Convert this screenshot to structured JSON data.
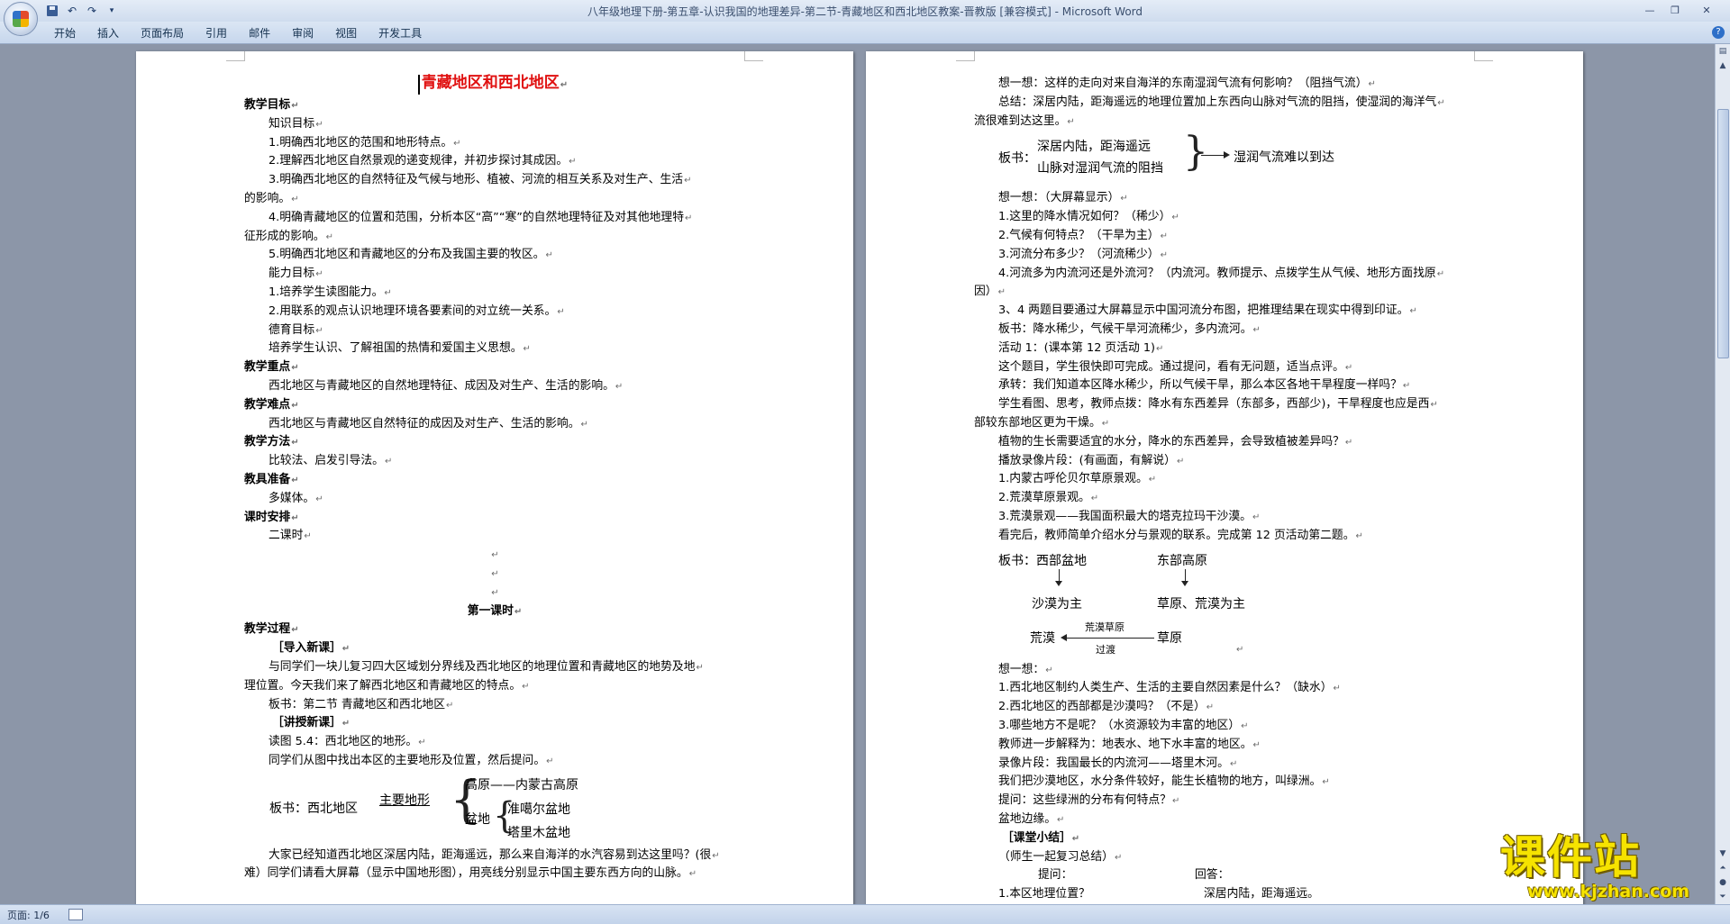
{
  "window": {
    "title": "八年级地理下册-第五章-认识我国的地理差异-第二节-青藏地区和西北地区教案-晋教版 [兼容模式] - Microsoft Word",
    "qat": [
      "save-icon",
      "undo-icon",
      "redo-icon",
      "customize-icon"
    ]
  },
  "ribbon": {
    "tabs": [
      "开始",
      "插入",
      "页面布局",
      "引用",
      "邮件",
      "审阅",
      "视图",
      "开发工具"
    ]
  },
  "left_page": {
    "title": "青藏地区和西北地区",
    "lines_top": [
      {
        "t": "教学目标",
        "c": "bold"
      },
      {
        "t": "知识目标",
        "c": "ind1"
      },
      {
        "t": "1.明确西北地区的范围和地形特点。",
        "c": "ind1"
      },
      {
        "t": "2.理解西北地区自然景观的递变规律，并初步探讨其成因。",
        "c": "ind1"
      },
      {
        "t": "3.明确西北地区的自然特征及气候与地形、植被、河流的相互关系及对生产、生活",
        "c": "ind1"
      },
      {
        "t": "的影响。",
        "c": ""
      },
      {
        "t": "4.明确青藏地区的位置和范围，分析本区“高”“寒”的自然地理特征及对其他地理特",
        "c": "ind1"
      },
      {
        "t": "征形成的影响。",
        "c": ""
      },
      {
        "t": "5.明确西北地区和青藏地区的分布及我国主要的牧区。",
        "c": "ind1"
      },
      {
        "t": "能力目标",
        "c": "ind1"
      },
      {
        "t": "1.培养学生读图能力。",
        "c": "ind1"
      },
      {
        "t": "2.用联系的观点认识地理环境各要素间的对立统一关系。",
        "c": "ind1"
      },
      {
        "t": "德育目标",
        "c": "ind1"
      },
      {
        "t": "培养学生认识、了解祖国的热情和爱国主义思想。",
        "c": "ind1"
      },
      {
        "t": "教学重点",
        "c": "bold"
      },
      {
        "t": "西北地区与青藏地区的自然地理特征、成因及对生产、生活的影响。",
        "c": "ind1"
      },
      {
        "t": "教学难点",
        "c": "bold"
      },
      {
        "t": "西北地区与青藏地区自然特征的成因及对生产、生活的影响。",
        "c": "ind1"
      },
      {
        "t": "教学方法",
        "c": "bold"
      },
      {
        "t": "比较法、启发引导法。",
        "c": "ind1"
      },
      {
        "t": "教具准备",
        "c": "bold"
      },
      {
        "t": "多媒体。",
        "c": "ind1"
      },
      {
        "t": "课时安排",
        "c": "bold"
      },
      {
        "t": "二课时",
        "c": "ind1"
      },
      {
        "t": "",
        "c": "center"
      },
      {
        "t": "",
        "c": "center"
      },
      {
        "t": "",
        "c": "center"
      },
      {
        "t": "第一课时",
        "c": "bold center"
      },
      {
        "t": "教学过程",
        "c": "bold"
      },
      {
        "t": "［导入新课］",
        "c": "ind2 bold"
      },
      {
        "t": "与同学们一块儿复习四大区域划分界线及西北地区的地理位置和青藏地区的地势及地",
        "c": "ind1"
      },
      {
        "t": "理位置。今天我们来了解西北地区和青藏地区的特点。",
        "c": ""
      },
      {
        "t": "板书：第二节   青藏地区和西北地区",
        "c": "ind1"
      },
      {
        "t": "［讲授新课］",
        "c": "ind2 bold"
      },
      {
        "t": "读图 5.4：西北地区的地形。",
        "c": "ind1"
      },
      {
        "t": "同学们从图中找出本区的主要地形及位置，然后提问。",
        "c": "ind1"
      }
    ],
    "board": {
      "prefix": "板书：西北地区",
      "main": "主要地形",
      "plateau": "高原——内蒙古高原",
      "basin": "盆地",
      "basin1": "准噶尔盆地",
      "basin2": "塔里木盆地"
    },
    "lines_bottom": [
      {
        "t": "大家已经知道西北地区深居内陆，距海遥远，那么来自海洋的水汽容易到达这里吗？(很",
        "c": "ind1"
      },
      {
        "t": "难）同学们请看大屏幕（显示中国地形图），用亮线分别显示中国主要东西方向的山脉。",
        "c": ""
      }
    ]
  },
  "right_page": {
    "lines_a": [
      {
        "t": "想一想：这样的走向对来自海洋的东南湿润气流有何影响？（阻挡气流）",
        "c": "ind1"
      },
      {
        "t": "总结：深居内陆，距海遥远的地理位置加上东西向山脉对气流的阻挡，使湿润的海洋气",
        "c": "ind1"
      },
      {
        "t": "流很难到达这里。",
        "c": ""
      }
    ],
    "board2": {
      "label": "板书：",
      "l1": "深居内陆，距海遥远",
      "l2": "山脉对湿润气流的阻挡",
      "result": "湿润气流难以到达"
    },
    "lines_b": [
      {
        "t": "想一想：（大屏幕显示）",
        "c": "ind1"
      },
      {
        "t": "1.这里的降水情况如何？（稀少）",
        "c": "ind1"
      },
      {
        "t": "2.气候有何特点？（干旱为主）",
        "c": "ind1"
      },
      {
        "t": "3.河流分布多少？（河流稀少）",
        "c": "ind1"
      },
      {
        "t": "4.河流多为内流河还是外流河？（内流河。教师提示、点拨学生从气候、地形方面找原",
        "c": "ind1"
      },
      {
        "t": "因）",
        "c": ""
      },
      {
        "t": "3、4 两题目要通过大屏幕显示中国河流分布图，把推理结果在现实中得到印证。",
        "c": "ind1"
      },
      {
        "t": "板书：降水稀少，气候干旱河流稀少，多内流河。",
        "c": "ind1"
      },
      {
        "t": "活动 1：(课本第 12 页活动 1)",
        "c": "ind1"
      },
      {
        "t": "这个题目，学生很快即可完成。通过提问，看有无问题，适当点评。",
        "c": "ind1"
      },
      {
        "t": "承转：我们知道本区降水稀少，所以气候干旱，那么本区各地干旱程度一样吗？",
        "c": "ind1"
      },
      {
        "t": "学生看图、思考，教师点拨：降水有东西差异（东部多，西部少)，干旱程度也应是西",
        "c": "ind1"
      },
      {
        "t": "部较东部地区更为干燥。",
        "c": ""
      },
      {
        "t": "植物的生长需要适宜的水分，降水的东西差异，会导致植被差异吗？",
        "c": "ind1"
      },
      {
        "t": "播放录像片段：(有画面，有解说）",
        "c": "ind1"
      },
      {
        "t": "1.内蒙古呼伦贝尔草原景观。",
        "c": "ind1"
      },
      {
        "t": "2.荒漠草原景观。",
        "c": "ind1"
      },
      {
        "t": "3.荒漠景观——我国面积最大的塔克拉玛干沙漠。",
        "c": "ind1"
      },
      {
        "t": "看完后，教师简单介绍水分与景观的联系。完成第 12 页活动第二题。",
        "c": "ind1"
      }
    ],
    "board3": {
      "west": "板书：西部盆地",
      "east": "东部高原",
      "desert_main": "沙漠为主",
      "grass_main": "草原、荒漠为主",
      "desert": "荒漠",
      "grass": "草原",
      "mid_top": "荒漠草原",
      "mid_bottom": "过渡"
    },
    "lines_c": [
      {
        "t": "想一想：",
        "c": "ind1"
      },
      {
        "t": "1.西北地区制约人类生产、生活的主要自然因素是什么？（缺水）",
        "c": "ind1"
      },
      {
        "t": "2.西北地区的西部都是沙漠吗？（不是）",
        "c": "ind1"
      },
      {
        "t": "3.哪些地方不是呢？（水资源较为丰富的地区）",
        "c": "ind1"
      },
      {
        "t": "教师进一步解释为：地表水、地下水丰富的地区。",
        "c": "ind1"
      },
      {
        "t": "录像片段：我国最长的内流河——塔里木河。",
        "c": "ind1"
      },
      {
        "t": "我们把沙漠地区，水分条件较好，能生长植物的地方，叫绿洲。",
        "c": "ind1"
      },
      {
        "t": "提问：这些绿洲的分布有何特点？",
        "c": "ind1"
      },
      {
        "t": "盆地边缘。",
        "c": "ind1"
      },
      {
        "t": "［课堂小结］",
        "c": "ind2 bold"
      },
      {
        "t": "（师生一起复习总结）",
        "c": "ind1"
      }
    ],
    "qa_head": {
      "q": "提问：",
      "a": "回答："
    },
    "qa_row": {
      "q": "1.本区地理位置？",
      "a": "深居内陆，距海遥远。"
    }
  },
  "statusbar": {
    "page_count": "页面: 1/6"
  },
  "watermark": {
    "cn": "课件站",
    "url": "www.kjzhan.com"
  },
  "colors": {
    "title_red": "#e01010",
    "workspace": "#8c96a8",
    "watermark_yellow": "#f6e300"
  }
}
